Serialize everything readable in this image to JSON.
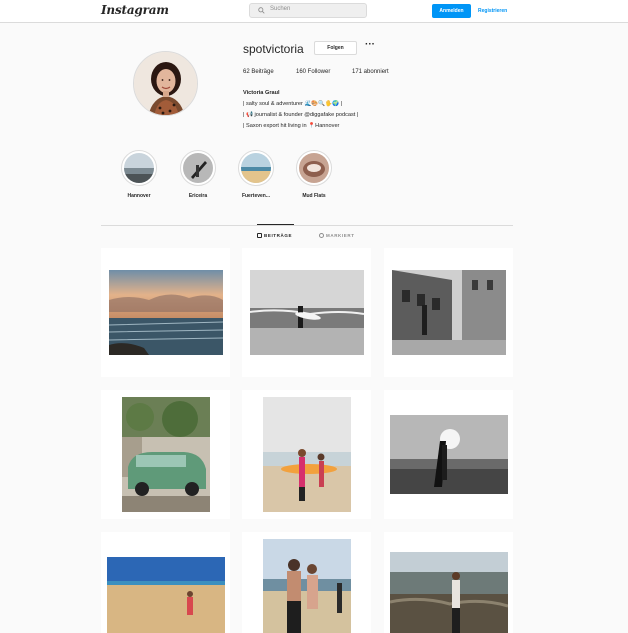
{
  "nav": {
    "logo": "Instagram",
    "search_placeholder": "Suchen",
    "login_label": "Anmelden",
    "register_label": "Registrieren"
  },
  "profile": {
    "username": "spotvictoria",
    "follow_label": "Folgen",
    "more_label": "···",
    "posts": "62 Beiträge",
    "followers": "160 Follower",
    "following": "171 abonniert",
    "display_name": "Victoria Graul",
    "bio_lines": [
      "| salty soul & adventurer 🌊🎨🔍🖐️🌍 |",
      "| 📢 journalist & founder @diggafake podcast |",
      "| Saxon export hit living in 📍Hannover"
    ]
  },
  "highlights": [
    {
      "label": "Hannover"
    },
    {
      "label": "Ericeira"
    },
    {
      "label": "Fuerteven..."
    },
    {
      "label": "Mud Flats"
    }
  ],
  "tabs": {
    "posts_label": "BEITRÄGE",
    "tagged_label": "MARKIERT"
  },
  "colors": {
    "accent": "#0095f6",
    "border": "#dbdbdb",
    "background": "#fafafa"
  },
  "posts": [
    {
      "subject": "sunset over sea"
    },
    {
      "subject": "surfer on beach bw"
    },
    {
      "subject": "old street bw"
    },
    {
      "subject": "vintage green car"
    },
    {
      "subject": "women with surfboard"
    },
    {
      "subject": "silhouette with surfboard bw"
    },
    {
      "subject": "person on sand beach"
    },
    {
      "subject": "couple on beach"
    },
    {
      "subject": "woman on rocky coast"
    }
  ]
}
